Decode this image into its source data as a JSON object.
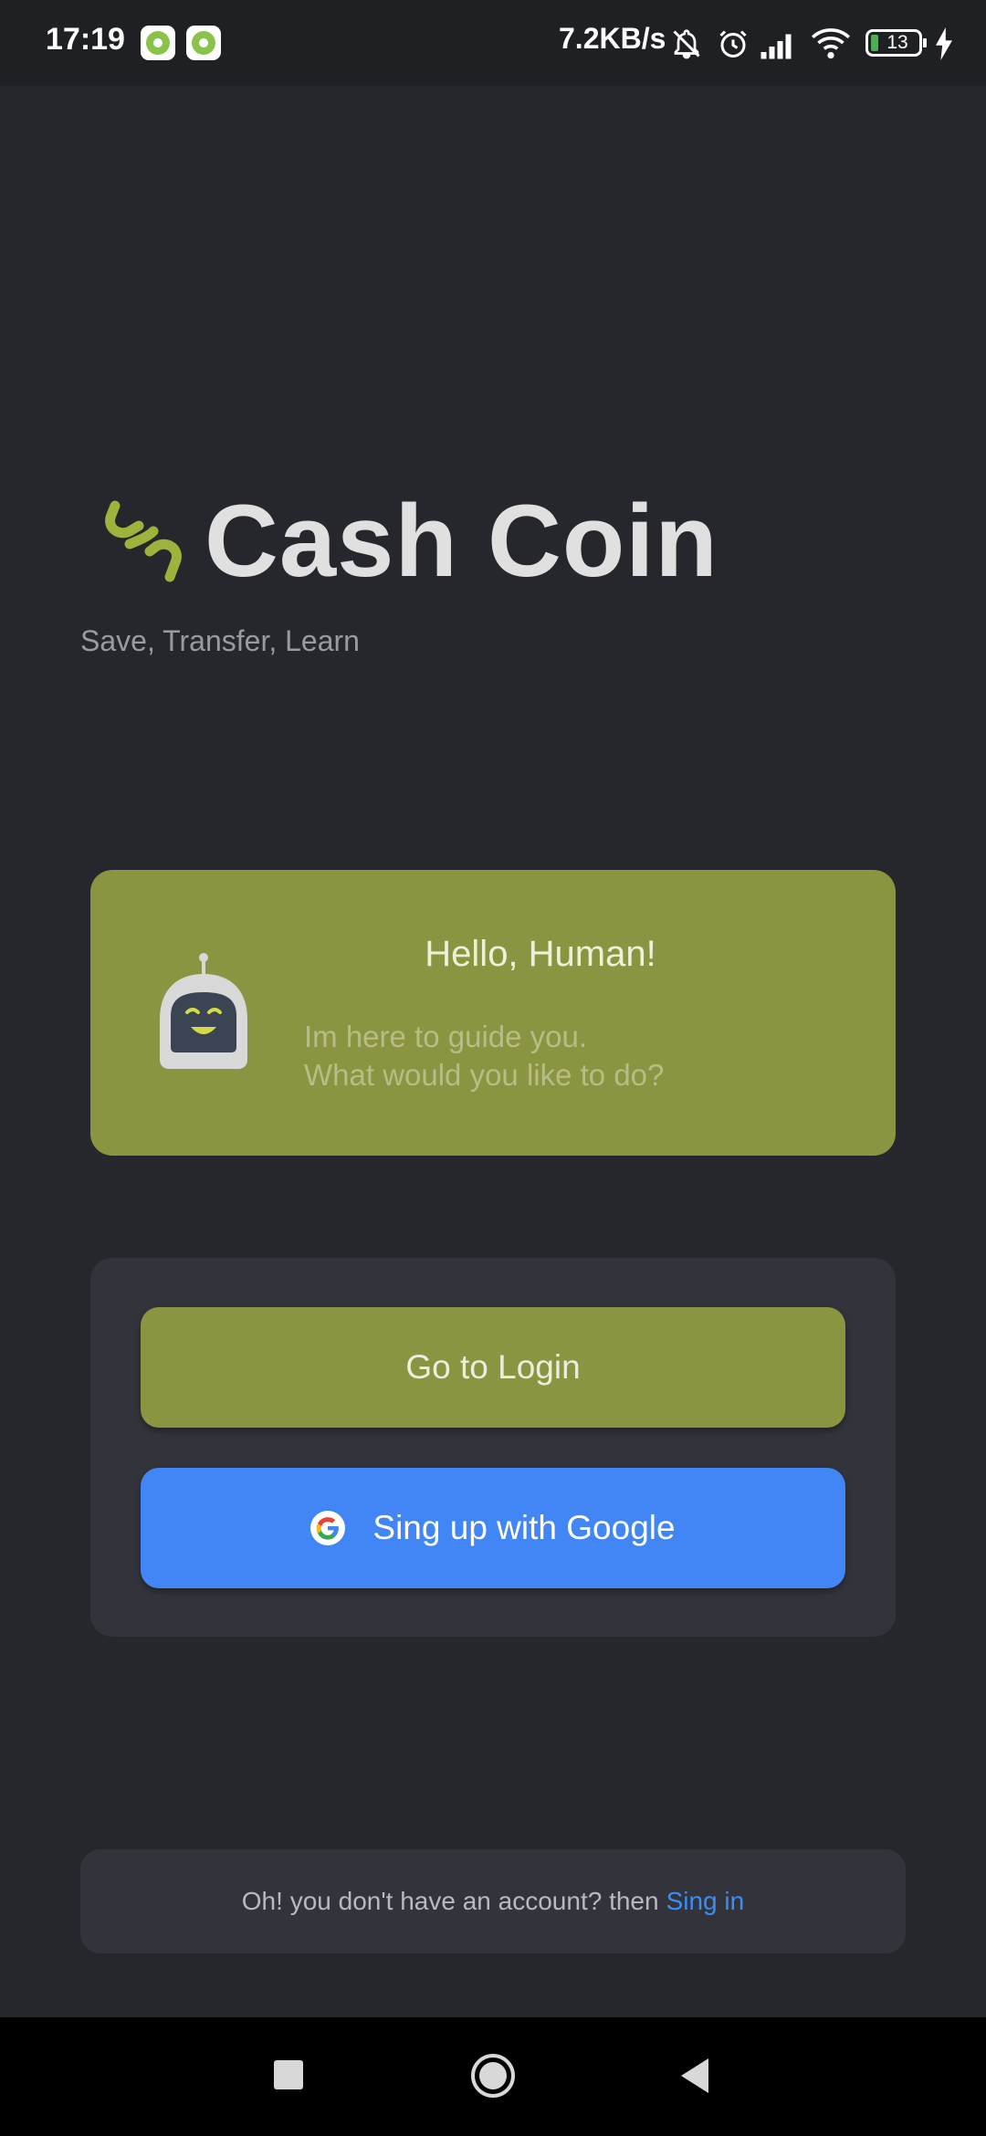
{
  "status_bar": {
    "time": "17:19",
    "network_speed": "7.2KB/s",
    "battery_level": "13",
    "icons": [
      "notification-app-icon",
      "notification-app-icon",
      "mute-icon",
      "alarm-icon",
      "signal-icon",
      "wifi-icon",
      "battery-icon",
      "charging-icon"
    ]
  },
  "header": {
    "app_name": "Cash Coin",
    "tagline": "Save, Transfer, Learn",
    "logo_icon": "chain-link-icon",
    "accent_color": "#9db33b"
  },
  "guide_card": {
    "title": "Hello, Human!",
    "message_line1": "Im here to guide you.",
    "message_line2": "What would you like to do?",
    "avatar_icon": "robot-icon",
    "background_color": "#8b9441"
  },
  "actions": {
    "login_label": "Go to Login",
    "google_label": "Sing up with Google",
    "google_icon": "google-g-icon",
    "google_color": "#4285f4"
  },
  "footer_notice": {
    "text": "Oh! you don't have an account? then",
    "link_label": "Sing in"
  },
  "nav_bar": {
    "icons": [
      "recents-icon",
      "home-icon",
      "back-icon"
    ]
  }
}
